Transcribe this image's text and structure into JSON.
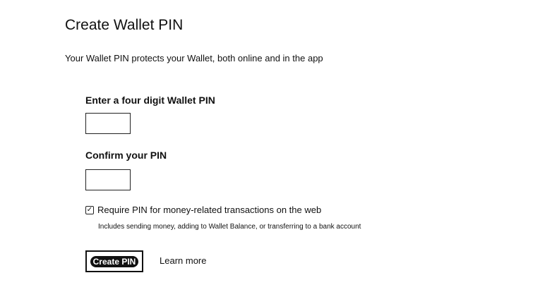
{
  "header": {
    "title": "Create Wallet PIN",
    "subtitle": "Your Wallet PIN protects your Wallet, both online and in the app"
  },
  "form": {
    "pin_label": "Enter a four digit Wallet PIN",
    "pin_value": "",
    "confirm_label": "Confirm your PIN",
    "confirm_value": "",
    "require_pin": {
      "checked": true,
      "check_glyph": "✓",
      "label": "Require PIN for money-related transactions on the web",
      "help": "Includes sending money, adding to Wallet Balance, or transferring to a bank account"
    },
    "create_button_label": "Create PIN",
    "learn_more_label": "Learn more"
  }
}
